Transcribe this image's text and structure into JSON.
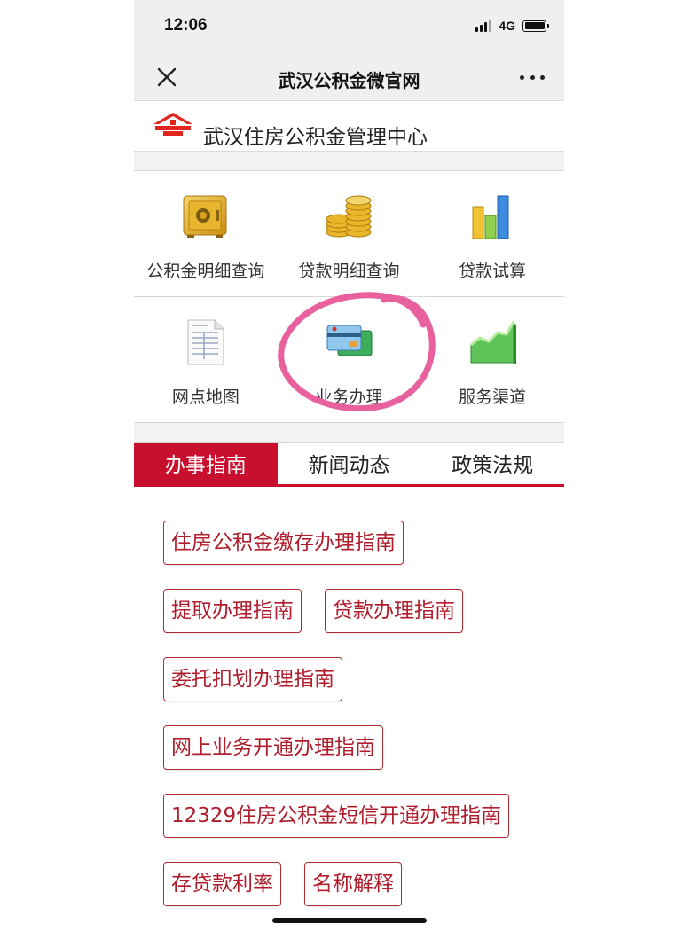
{
  "status": {
    "time": "12:06",
    "network": "4G"
  },
  "nav": {
    "title": "武汉公积金微官网"
  },
  "header": {
    "site_name": "武汉住房公积金管理中心"
  },
  "colors": {
    "brand_red": "#c8102e",
    "button_border": "#b22a33",
    "highlight_circle": "#e8609e"
  },
  "grid": [
    [
      {
        "label": "公积金明细查询",
        "icon": "safe-icon"
      },
      {
        "label": "贷款明细查询",
        "icon": "coins-icon"
      },
      {
        "label": "贷款试算",
        "icon": "bar-chart-icon"
      }
    ],
    [
      {
        "label": "网点地图",
        "icon": "document-icon"
      },
      {
        "label": "业务办理",
        "icon": "bank-card-icon"
      },
      {
        "label": "服务渠道",
        "icon": "area-chart-icon"
      }
    ]
  ],
  "tabs": [
    {
      "label": "办事指南",
      "active": true
    },
    {
      "label": "新闻动态",
      "active": false
    },
    {
      "label": "政策法规",
      "active": false
    }
  ],
  "guides": [
    [
      "住房公积金缴存办理指南"
    ],
    [
      "提取办理指南",
      "贷款办理指南"
    ],
    [
      "委托扣划办理指南"
    ],
    [
      "网上业务开通办理指南"
    ],
    [
      "12329住房公积金短信开通办理指南"
    ],
    [
      "存贷款利率",
      "名称解释"
    ]
  ]
}
